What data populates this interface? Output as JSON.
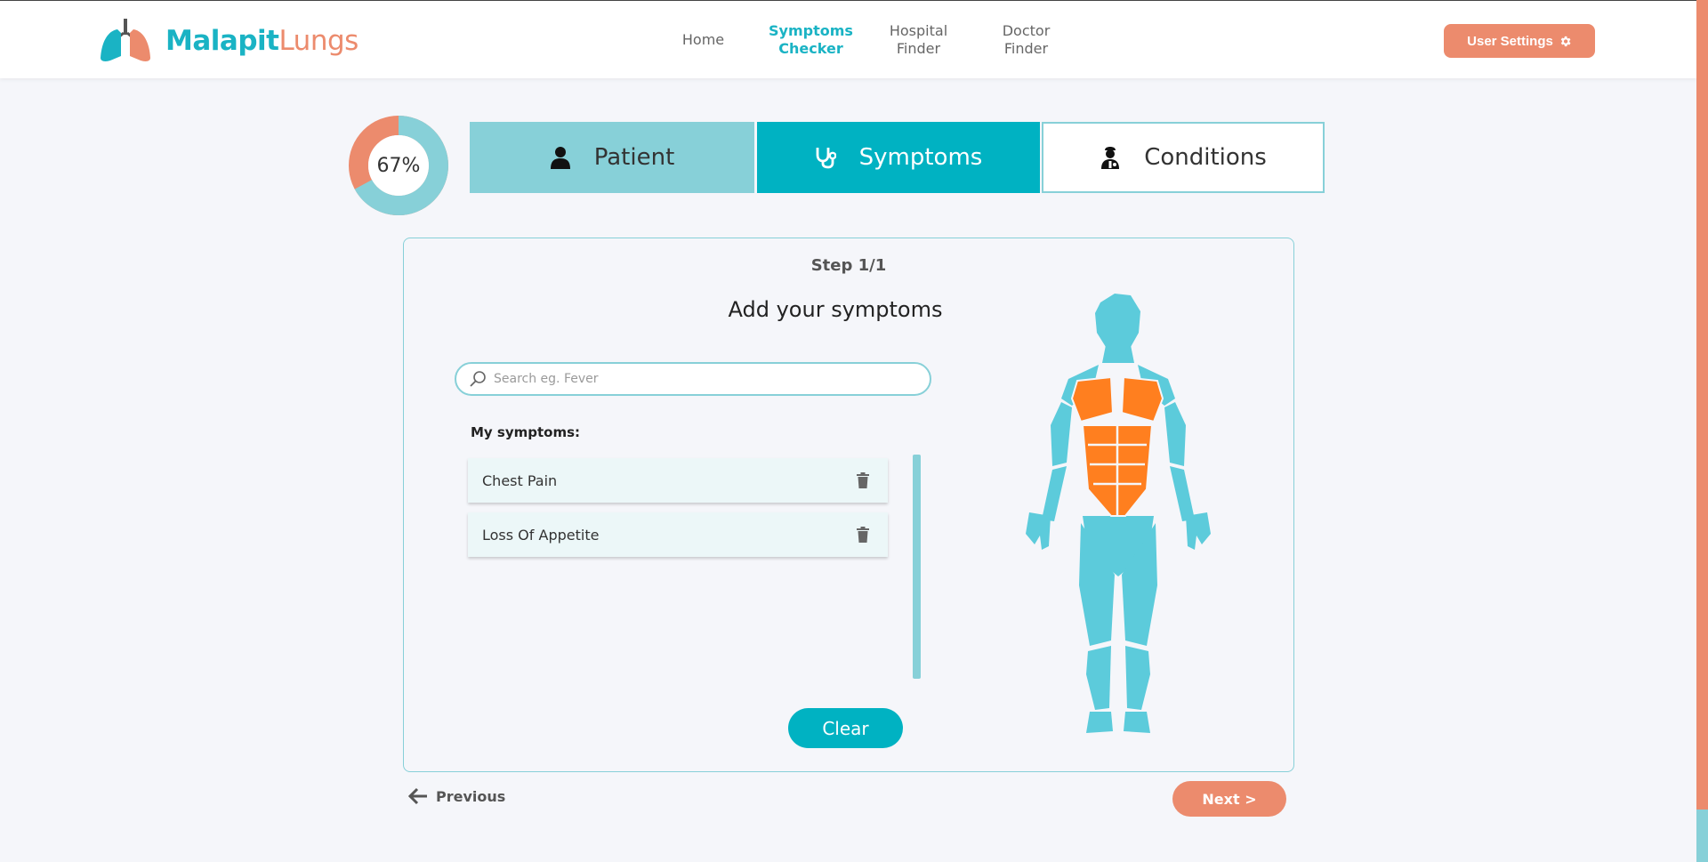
{
  "brand": {
    "name_part1": "Malapit",
    "name_part2": "Lungs"
  },
  "nav": {
    "items": [
      {
        "label": "Home",
        "active": false
      },
      {
        "label": "Symptoms\nChecker",
        "active": true
      },
      {
        "label": "Hospital\nFinder",
        "active": false
      },
      {
        "label": "Doctor\nFinder",
        "active": false
      }
    ],
    "user_settings_label": "User Settings"
  },
  "progress": {
    "percent": 67,
    "label": "67%"
  },
  "tabs": [
    {
      "label": "Patient",
      "state": "completed",
      "icon": "person-icon"
    },
    {
      "label": "Symptoms",
      "state": "active",
      "icon": "stethoscope-icon"
    },
    {
      "label": "Conditions",
      "state": "pending",
      "icon": "doctor-icon"
    }
  ],
  "card": {
    "step": "Step 1/1",
    "title": "Add your symptoms",
    "search_placeholder": "Search eg. Fever",
    "my_symptoms_label": "My symptoms:",
    "symptoms": [
      {
        "name": "Chest Pain"
      },
      {
        "name": "Loss Of Appetite"
      }
    ],
    "clear_label": "Clear"
  },
  "footer": {
    "previous_label": "Previous",
    "next_label": "Next >"
  },
  "colors": {
    "teal": "#00b2c2",
    "teal_light": "#87d0d8",
    "coral": "#ec8b6d",
    "highlight": "#ff7f1f"
  }
}
